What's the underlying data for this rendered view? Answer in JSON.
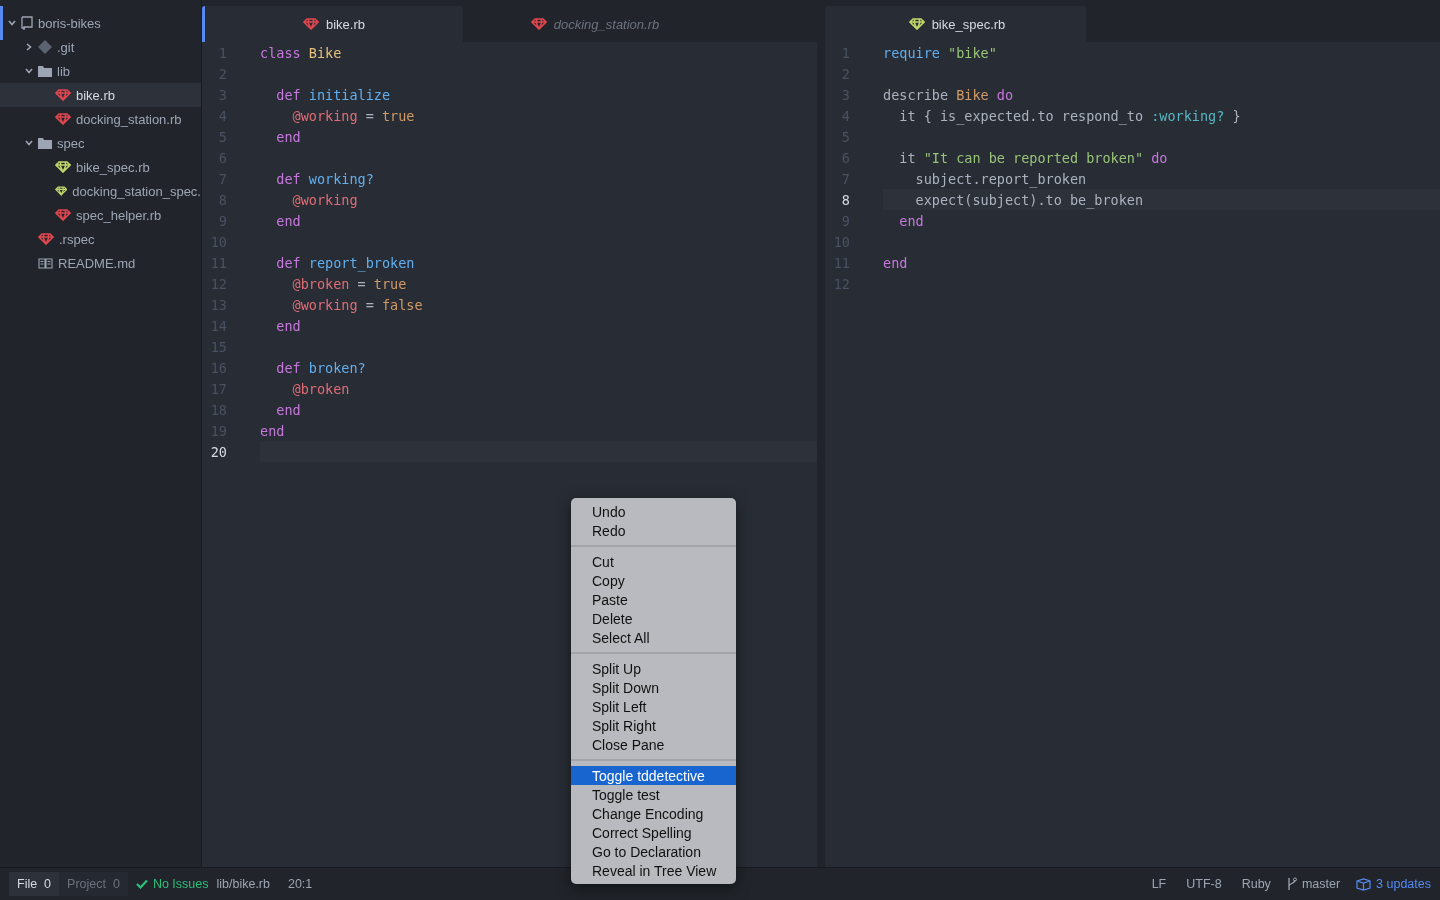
{
  "sidebar": {
    "tree": [
      {
        "label": "boris-bikes",
        "kind": "project",
        "expanded": true,
        "selected": false,
        "children": [
          {
            "label": ".git",
            "kind": "git",
            "expanded": false,
            "selected": false
          },
          {
            "label": "lib",
            "kind": "folder",
            "expanded": true,
            "selected": false,
            "children": [
              {
                "label": "bike.rb",
                "kind": "ruby",
                "selected": true
              },
              {
                "label": "docking_station.rb",
                "kind": "ruby",
                "selected": false
              }
            ]
          },
          {
            "label": "spec",
            "kind": "folder",
            "expanded": true,
            "selected": false,
            "children": [
              {
                "label": "bike_spec.rb",
                "kind": "spec",
                "selected": false
              },
              {
                "label": "docking_station_spec.",
                "kind": "spec",
                "selected": false
              },
              {
                "label": "spec_helper.rb",
                "kind": "ruby",
                "selected": false
              }
            ]
          },
          {
            "label": ".rspec",
            "kind": "ruby",
            "selected": false
          },
          {
            "label": "README.md",
            "kind": "readme",
            "selected": false
          }
        ]
      }
    ]
  },
  "panes": [
    {
      "active": true,
      "tabs": [
        {
          "label": "bike.rb",
          "kind": "ruby",
          "selected": true,
          "pending": false
        },
        {
          "label": "docking_station.rb",
          "kind": "ruby",
          "selected": false,
          "pending": true
        }
      ],
      "lines": [
        {
          "n": "1",
          "current": false,
          "tokens": [
            {
              "text": "class ",
              "kind": "keyword"
            },
            {
              "text": "Bike",
              "kind": "constant"
            }
          ]
        },
        {
          "n": "2",
          "current": false
        },
        {
          "n": "3",
          "current": false,
          "tokens": [
            {
              "text": "  def ",
              "kind": "keyword"
            },
            {
              "text": "initialize",
              "kind": "name"
            }
          ]
        },
        {
          "n": "4",
          "current": false,
          "tokens": [
            {
              "text": "    @working",
              "kind": "ivar"
            },
            {
              "text": " = ",
              "kind": "plain"
            },
            {
              "text": "true",
              "kind": "literal"
            }
          ]
        },
        {
          "n": "5",
          "current": false,
          "tokens": [
            {
              "text": "  end",
              "kind": "keyword"
            }
          ]
        },
        {
          "n": "6",
          "current": false
        },
        {
          "n": "7",
          "current": false,
          "tokens": [
            {
              "text": "  def ",
              "kind": "keyword"
            },
            {
              "text": "working?",
              "kind": "name"
            }
          ]
        },
        {
          "n": "8",
          "current": false,
          "tokens": [
            {
              "text": "    @working",
              "kind": "ivar"
            }
          ]
        },
        {
          "n": "9",
          "current": false,
          "tokens": [
            {
              "text": "  end",
              "kind": "keyword"
            }
          ]
        },
        {
          "n": "10",
          "current": false
        },
        {
          "n": "11",
          "current": false,
          "tokens": [
            {
              "text": "  def ",
              "kind": "keyword"
            },
            {
              "text": "report_broken",
              "kind": "name"
            }
          ]
        },
        {
          "n": "12",
          "current": false,
          "tokens": [
            {
              "text": "    @broken",
              "kind": "ivar"
            },
            {
              "text": " = ",
              "kind": "plain"
            },
            {
              "text": "true",
              "kind": "literal"
            }
          ]
        },
        {
          "n": "13",
          "current": false,
          "tokens": [
            {
              "text": "    @working",
              "kind": "ivar"
            },
            {
              "text": " = ",
              "kind": "plain"
            },
            {
              "text": "false",
              "kind": "literal"
            }
          ]
        },
        {
          "n": "14",
          "current": false,
          "tokens": [
            {
              "text": "  end",
              "kind": "keyword"
            }
          ]
        },
        {
          "n": "15",
          "current": false
        },
        {
          "n": "16",
          "current": false,
          "tokens": [
            {
              "text": "  def ",
              "kind": "keyword"
            },
            {
              "text": "broken?",
              "kind": "name"
            }
          ]
        },
        {
          "n": "17",
          "current": false,
          "tokens": [
            {
              "text": "    @broken",
              "kind": "ivar"
            }
          ]
        },
        {
          "n": "18",
          "current": false,
          "tokens": [
            {
              "text": "  end",
              "kind": "keyword"
            }
          ]
        },
        {
          "n": "19",
          "current": false,
          "tokens": [
            {
              "text": "end",
              "kind": "keyword"
            }
          ]
        },
        {
          "n": "20",
          "current": true
        }
      ]
    },
    {
      "active": false,
      "tabs": [
        {
          "label": "bike_spec.rb",
          "kind": "spec",
          "selected": true,
          "pending": false
        }
      ],
      "lines": [
        {
          "n": "1",
          "current": false,
          "tokens": [
            {
              "text": "require ",
              "kind": "name"
            },
            {
              "text": "\"bike\"",
              "kind": "string"
            }
          ]
        },
        {
          "n": "2",
          "current": false
        },
        {
          "n": "3",
          "current": false,
          "tokens": [
            {
              "text": "describe ",
              "kind": "plain"
            },
            {
              "text": "Bike ",
              "kind": "literal"
            },
            {
              "text": "do",
              "kind": "keyword"
            }
          ]
        },
        {
          "n": "4",
          "current": false,
          "tokens": [
            {
              "text": "  it { is_expected.to respond_to ",
              "kind": "plain"
            },
            {
              "text": ":working?",
              "kind": "symbol"
            },
            {
              "text": " }",
              "kind": "plain"
            }
          ]
        },
        {
          "n": "5",
          "current": false
        },
        {
          "n": "6",
          "current": false,
          "tokens": [
            {
              "text": "  it ",
              "kind": "plain"
            },
            {
              "text": "\"It can be reported broken\" ",
              "kind": "string"
            },
            {
              "text": "do",
              "kind": "keyword"
            }
          ]
        },
        {
          "n": "7",
          "current": false,
          "tokens": [
            {
              "text": "    subject.report_broken",
              "kind": "plain"
            }
          ]
        },
        {
          "n": "8",
          "current": true,
          "tokens": [
            {
              "text": "    expect(subject).to be_broken",
              "kind": "plain"
            }
          ]
        },
        {
          "n": "9",
          "current": false,
          "tokens": [
            {
              "text": "  end",
              "kind": "keyword"
            }
          ]
        },
        {
          "n": "10",
          "current": false
        },
        {
          "n": "11",
          "current": false,
          "tokens": [
            {
              "text": "end",
              "kind": "keyword"
            }
          ]
        },
        {
          "n": "12",
          "current": false
        }
      ]
    }
  ],
  "context_menu": {
    "groups": [
      [
        {
          "label": "Undo",
          "selected": false
        },
        {
          "label": "Redo",
          "selected": false
        }
      ],
      [
        {
          "label": "Cut",
          "selected": false
        },
        {
          "label": "Copy",
          "selected": false
        },
        {
          "label": "Paste",
          "selected": false
        },
        {
          "label": "Delete",
          "selected": false
        },
        {
          "label": "Select All",
          "selected": false
        }
      ],
      [
        {
          "label": "Split Up",
          "selected": false
        },
        {
          "label": "Split Down",
          "selected": false
        },
        {
          "label": "Split Left",
          "selected": false
        },
        {
          "label": "Split Right",
          "selected": false
        },
        {
          "label": "Close Pane",
          "selected": false
        }
      ],
      [
        {
          "label": "Toggle tddetective",
          "selected": true
        },
        {
          "label": "Toggle test",
          "selected": false
        },
        {
          "label": "Change Encoding",
          "selected": false
        },
        {
          "label": "Correct Spelling",
          "selected": false
        },
        {
          "label": "Go to Declaration",
          "selected": false
        },
        {
          "label": "Reveal in Tree View",
          "selected": false
        }
      ]
    ]
  },
  "status_bar": {
    "scope_tabs": [
      {
        "label": "File",
        "count": "0",
        "selected": true
      },
      {
        "label": "Project",
        "count": "0",
        "selected": false
      }
    ],
    "issues": "No Issues",
    "path": "lib/bike.rb",
    "cursor": "20:1",
    "right": [
      {
        "label": "LF",
        "kind": "text"
      },
      {
        "label": "UTF-8",
        "kind": "text"
      },
      {
        "label": "Ruby",
        "kind": "text"
      },
      {
        "label": "master",
        "kind": "branch"
      },
      {
        "label": "3 updates",
        "kind": "updates"
      }
    ]
  }
}
